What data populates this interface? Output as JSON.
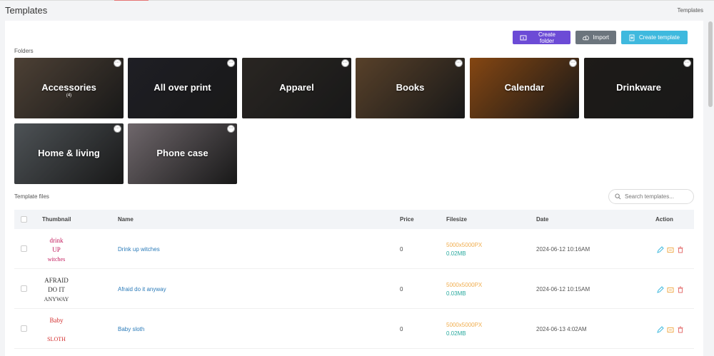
{
  "page": {
    "title": "Templates",
    "breadcrumb": "Templates"
  },
  "toolbar": {
    "create_folder": "Create folder",
    "import": "Import",
    "create_template": "Create template"
  },
  "folders_label": "Folders",
  "folders": [
    {
      "name": "Accessories",
      "count": "(4)",
      "color": "#6b5a4a"
    },
    {
      "name": "All over print",
      "count": "",
      "color": "#2b2b33"
    },
    {
      "name": "Apparel",
      "count": "",
      "color": "#3a3530"
    },
    {
      "name": "Books",
      "count": "",
      "color": "#7a5a3a"
    },
    {
      "name": "Calendar",
      "count": "",
      "color": "#b8621a"
    },
    {
      "name": "Drinkware",
      "count": "",
      "color": "#2a2622"
    },
    {
      "name": "Home & living",
      "count": "",
      "color": "#6c7378"
    },
    {
      "name": "Phone case",
      "count": "",
      "color": "#9a8f95"
    }
  ],
  "files_label": "Template files",
  "search": {
    "placeholder": "Search templates..."
  },
  "table": {
    "headers": {
      "thumbnail": "Thumbnail",
      "name": "Name",
      "price": "Price",
      "filesize": "Filesize",
      "date": "Date",
      "action": "Action"
    },
    "rows": [
      {
        "name": "Drink up witches",
        "price": "0",
        "dims": "5000x5000PX",
        "size": "0.02MB",
        "date": "2024-06-12 10:16AM",
        "thumb": [
          "drink",
          "UP",
          "witches"
        ]
      },
      {
        "name": "Afraid do it anyway",
        "price": "0",
        "dims": "5000x5000PX",
        "size": "0.03MB",
        "date": "2024-06-12 10:15AM",
        "thumb": [
          "AFRAID",
          "DO IT",
          "ANYWAY"
        ]
      },
      {
        "name": "Baby sloth",
        "price": "0",
        "dims": "5000x5000PX",
        "size": "0.02MB",
        "date": "2024-06-13 4:02AM",
        "thumb": [
          "Baby",
          "",
          "SLOTH"
        ]
      }
    ]
  }
}
